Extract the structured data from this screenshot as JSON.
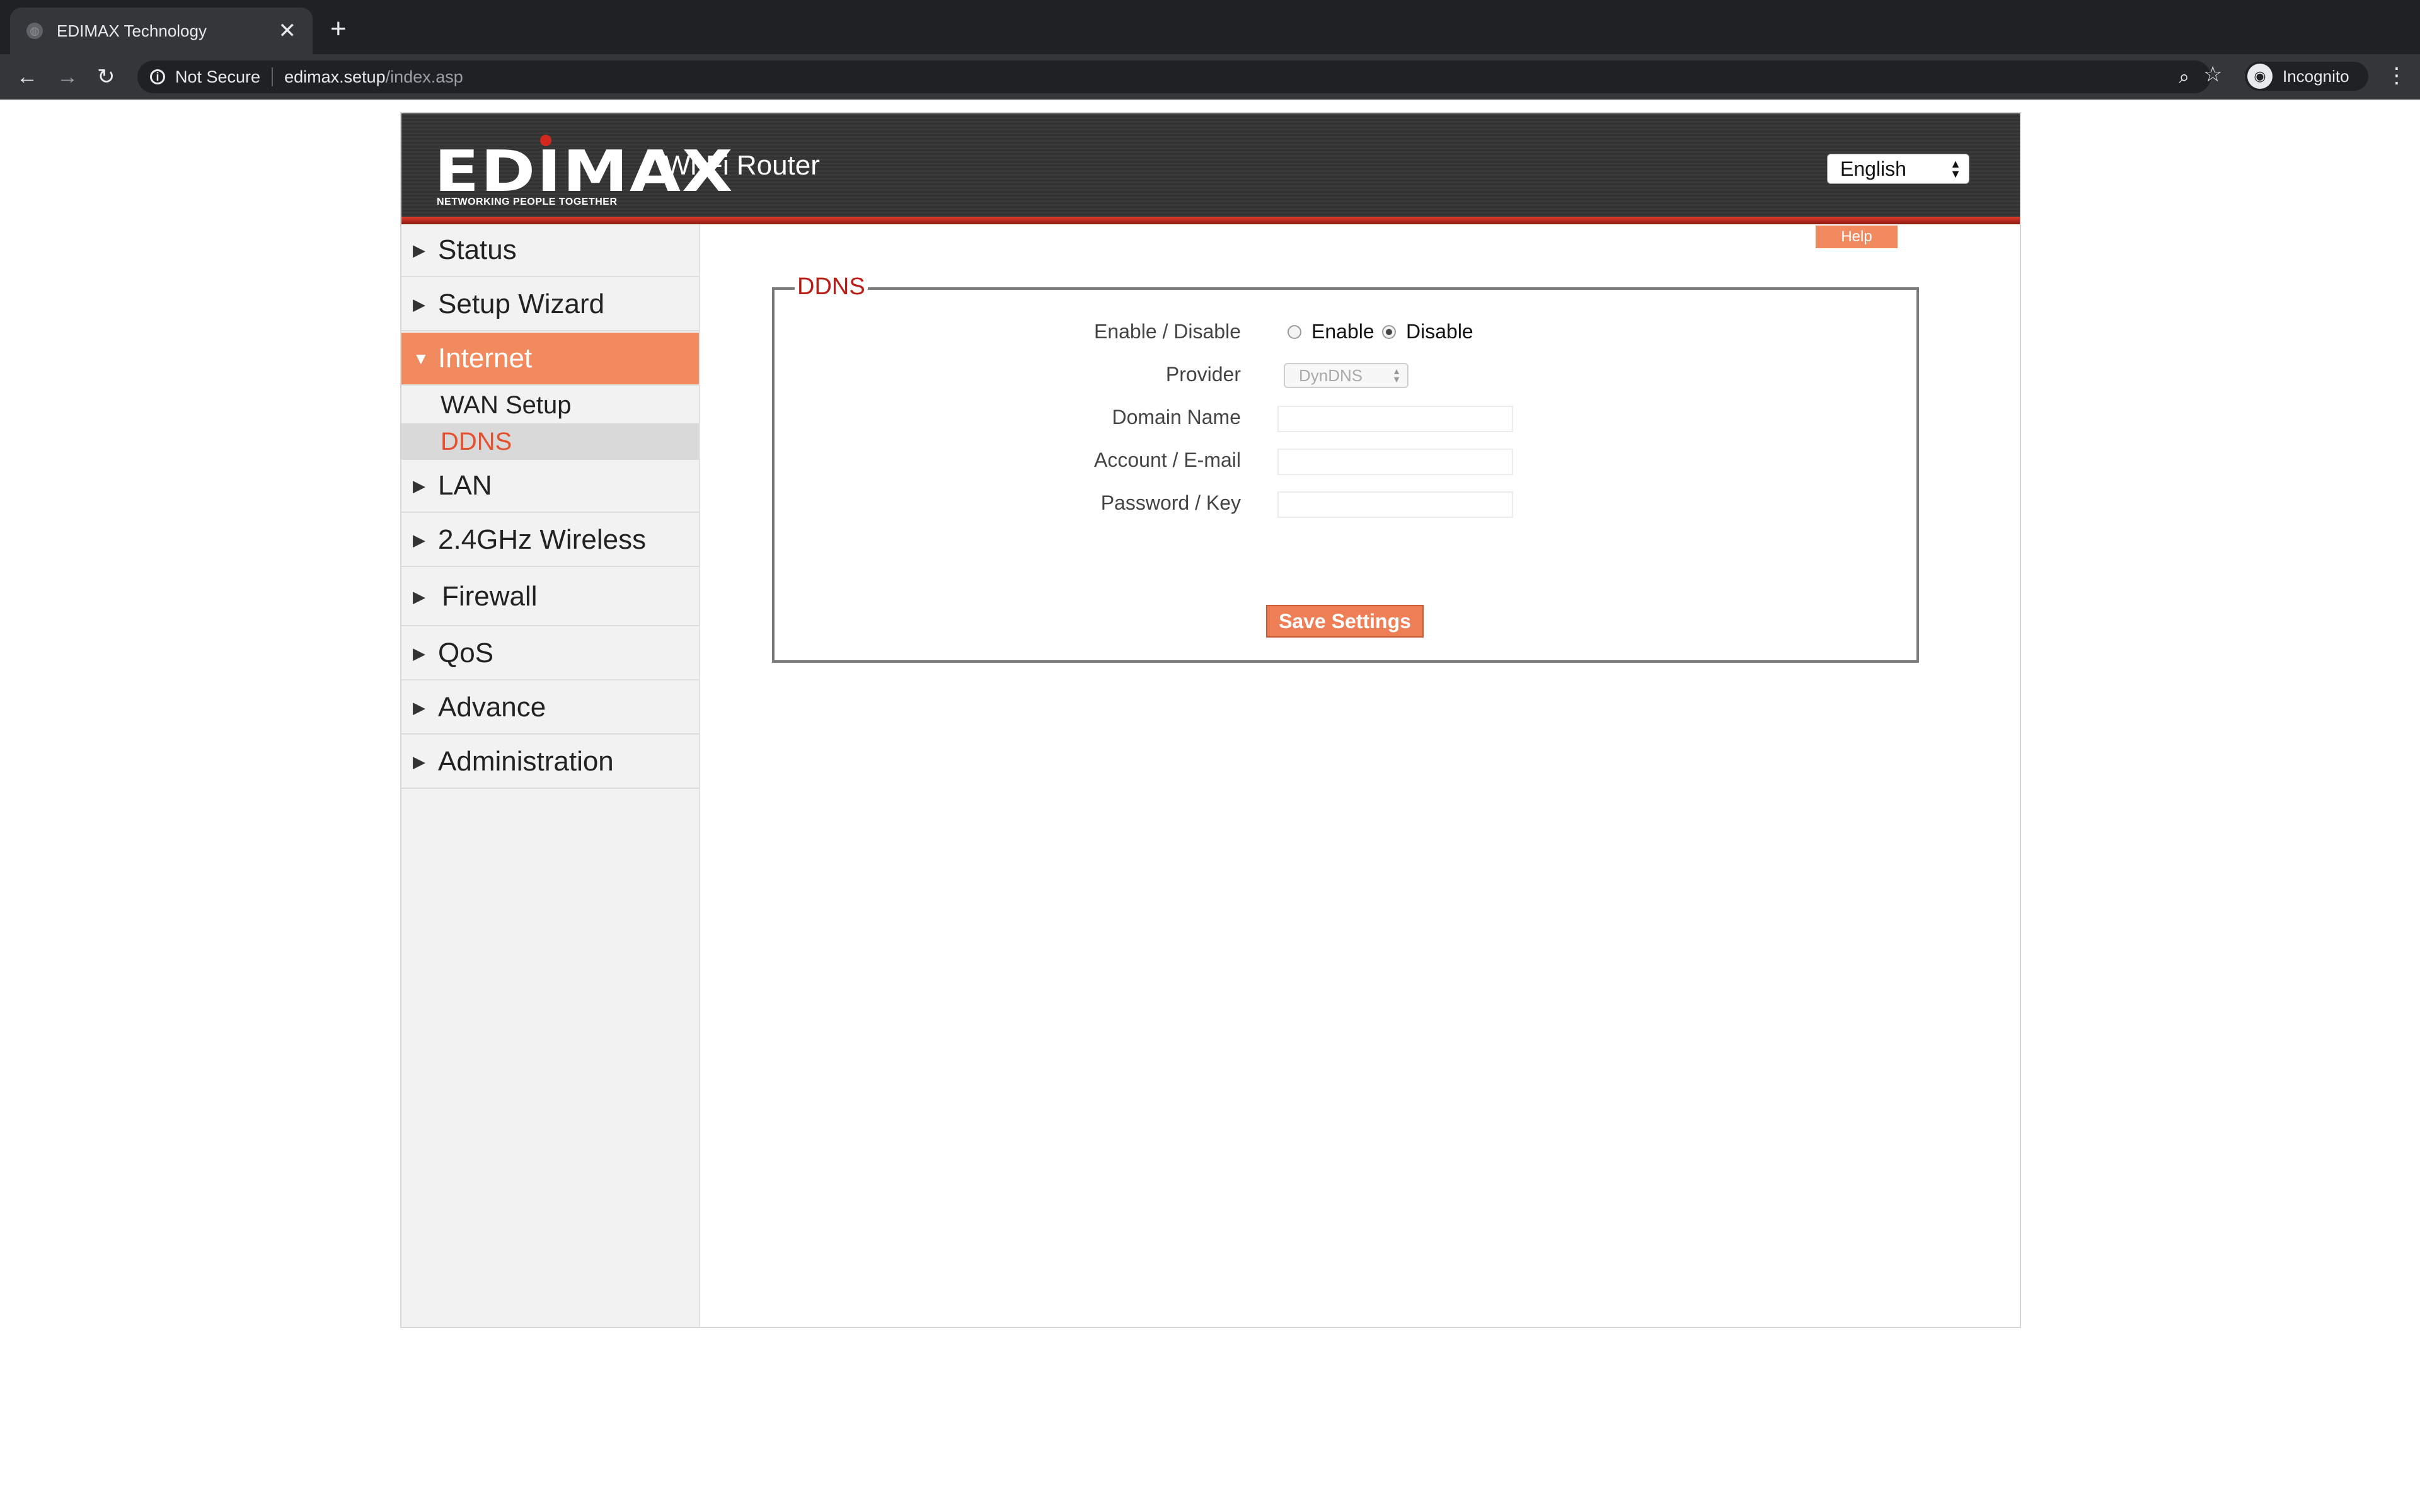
{
  "browser": {
    "tab_title": "EDIMAX Technology",
    "tab_close": "✕",
    "new_tab": "+",
    "back": "←",
    "forward": "→",
    "reload": "↻",
    "security_label": "Not Secure",
    "url_host": "edimax.setup",
    "url_path": "/index.asp",
    "zoom_icon": "⌕",
    "star_icon": "☆",
    "profile_label": "Incognito",
    "menu_icon": "⋮"
  },
  "header": {
    "logo_text": "EDIMAX",
    "logo_tagline": "NETWORKING PEOPLE TOGETHER",
    "product_title": "Wi-Fi Router",
    "language": "English"
  },
  "sidebar": {
    "items": [
      {
        "label": "Status",
        "arrow": "▶"
      },
      {
        "label": "Setup Wizard",
        "arrow": "▶"
      },
      {
        "label": "Internet",
        "arrow": "▼"
      },
      {
        "label": "LAN",
        "arrow": "▶"
      },
      {
        "label": "2.4GHz Wireless",
        "arrow": "▶"
      },
      {
        "label": "Firewall",
        "arrow": "▶"
      },
      {
        "label": "QoS",
        "arrow": "▶"
      },
      {
        "label": "Advance",
        "arrow": "▶"
      },
      {
        "label": "Administration",
        "arrow": "▶"
      }
    ],
    "internet_sub": [
      {
        "label": "WAN Setup"
      },
      {
        "label": "DDNS"
      }
    ]
  },
  "main": {
    "help_label": "Help",
    "panel_title": "DDNS",
    "enable_disable_label": "Enable / Disable",
    "enable_option": "Enable",
    "disable_option": "Disable",
    "selected_option": "Disable",
    "provider_label": "Provider",
    "provider_value": "DynDNS",
    "domain_label": "Domain Name",
    "domain_value": "",
    "account_label": "Account / E-mail",
    "account_value": "",
    "password_label": "Password / Key",
    "password_value": "",
    "save_label": "Save Settings"
  },
  "colors": {
    "accent": "#f18a5e",
    "brand_red": "#d2281e",
    "title_red": "#b81d16",
    "selected_text": "#e5502f"
  }
}
